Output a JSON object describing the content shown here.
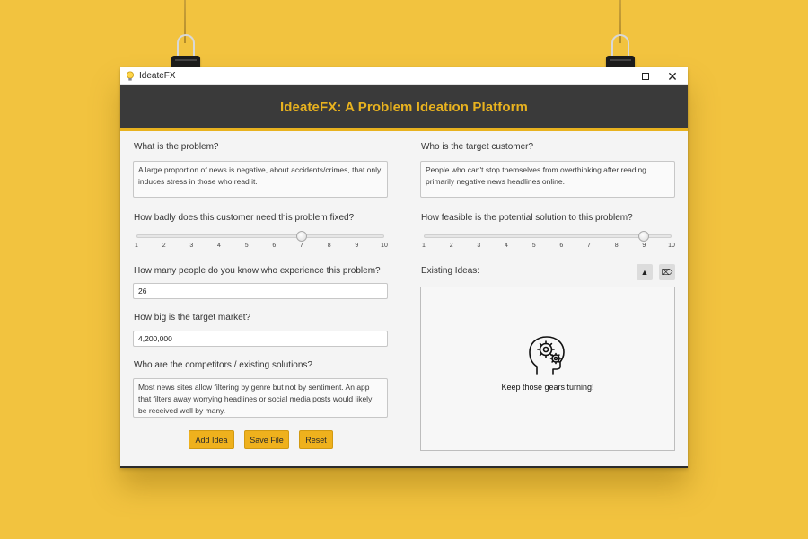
{
  "window": {
    "app_name": "IdeateFX"
  },
  "header": {
    "title": "IdeateFX: A Problem Ideation Platform"
  },
  "left": {
    "problem_label": "What is the problem?",
    "problem_text": "A large proportion of news is negative, about accidents/crimes, that only induces stress in those who read it.",
    "need_label": "How badly does this customer need this problem fixed?",
    "need_value": 7,
    "people_label": "How many people do you know who experience this problem?",
    "people_value": "26",
    "market_label": "How big is the target market?",
    "market_value": "4,200,000",
    "competitors_label": "Who are the competitors / existing solutions?",
    "competitors_text": "Most news sites allow filtering by genre but not by sentiment. An app that filters away worrying headlines or social media posts would likely be received well by many."
  },
  "right": {
    "customer_label": "Who is the target customer?",
    "customer_text": "People who can't stop themselves from overthinking after reading primarily negative news headlines online.",
    "feasible_label": "How feasible is the potential solution to this problem?",
    "feasible_value": 9,
    "ideas_label": "Existing Ideas:",
    "empty_message": "Keep those gears turning!"
  },
  "slider_ticks": [
    "1",
    "2",
    "3",
    "4",
    "5",
    "6",
    "7",
    "8",
    "9",
    "10"
  ],
  "buttons": {
    "add": "Add Idea",
    "save": "Save File",
    "reset": "Reset",
    "up_icon": "▲",
    "tag_icon": "⌦"
  },
  "colors": {
    "background": "#f2c33f",
    "header_bg": "#3a3a3a",
    "accent": "#e8b21f",
    "button": "#efb11d"
  }
}
